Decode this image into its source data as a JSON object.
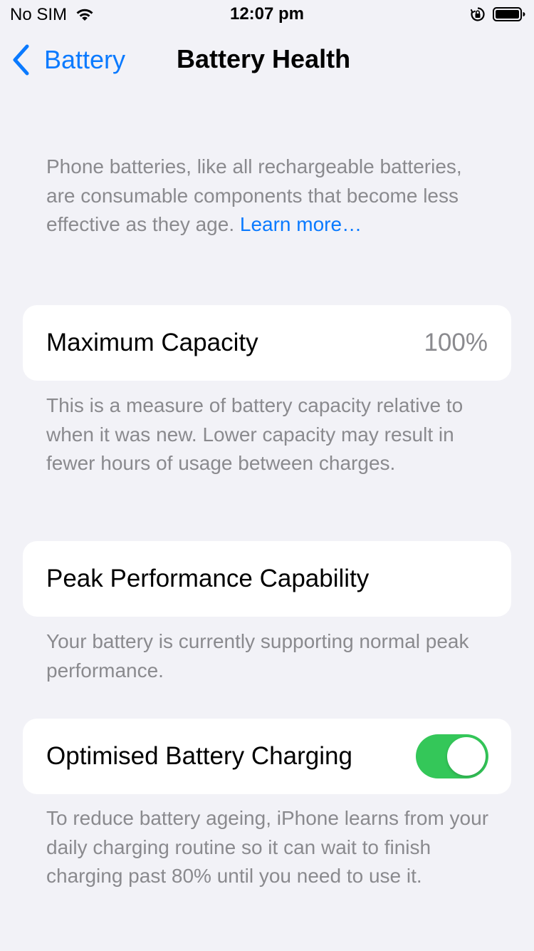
{
  "status_bar": {
    "carrier": "No SIM",
    "time": "12:07 pm",
    "icons": [
      "wifi-icon",
      "orientation-lock-icon",
      "battery-icon"
    ]
  },
  "nav": {
    "back_label": "Battery",
    "title": "Battery Health",
    "back_icon": "chevron-left-icon"
  },
  "intro": {
    "text": "Phone batteries, like all rechargeable batteries, are consumable components that become less effective as they age. ",
    "link": "Learn more…"
  },
  "max_capacity": {
    "label": "Maximum Capacity",
    "value": "100%",
    "footnote": "This is a measure of battery capacity relative to when it was new. Lower capacity may result in fewer hours of usage between charges."
  },
  "peak_performance": {
    "label": "Peak Performance Capability",
    "footnote": "Your battery is currently supporting normal peak performance."
  },
  "optimised_charging": {
    "label": "Optimised Battery Charging",
    "enabled": true,
    "footnote": "To reduce battery ageing, iPhone learns from your daily charging routine so it can wait to finish charging past 80% until you need to use it."
  },
  "colors": {
    "accent": "#0a7aff",
    "toggle_on": "#34c759",
    "background": "#f2f2f7",
    "secondary_text": "#8a8a8e"
  }
}
